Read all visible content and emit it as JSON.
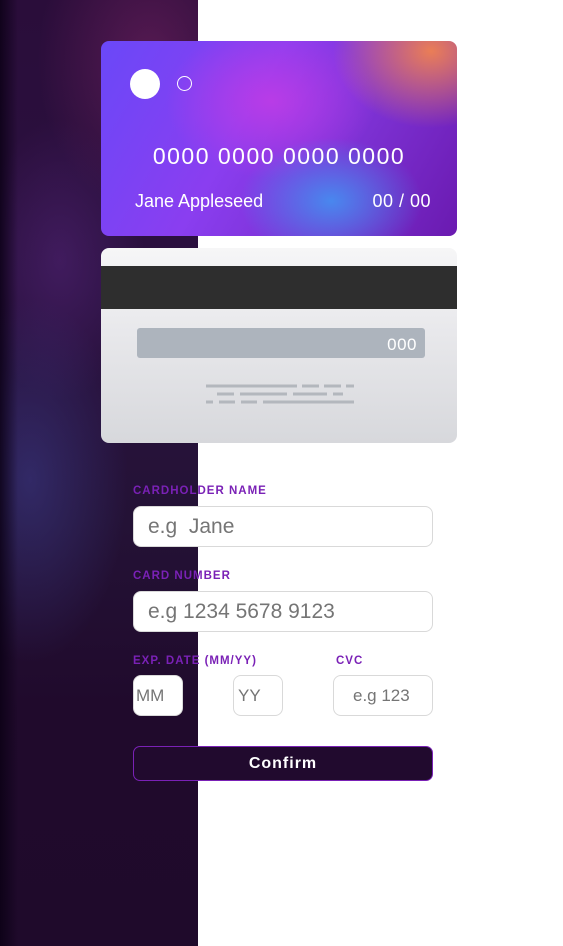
{
  "card_front": {
    "number": "0000 0000 0000 0000",
    "name": "Jane Appleseed",
    "expiry": "00 / 00"
  },
  "card_back": {
    "cvc": "000"
  },
  "form": {
    "name_label": "CARDHOLDER NAME",
    "name_placeholder": "e.g  Jane",
    "number_label": "CARD NUMBER",
    "number_placeholder": "e.g 1234 5678 9123",
    "exp_label": "EXP. DATE (MM/YY)",
    "mm_placeholder": "MM",
    "yy_placeholder": "YY",
    "cvc_label": "CVC",
    "cvc_placeholder": "e.g 123",
    "confirm_label": "Confirm"
  },
  "colors": {
    "accent": "#7a21b6",
    "button_bg": "#210a2e",
    "side_bg": "#2a0d3a"
  }
}
